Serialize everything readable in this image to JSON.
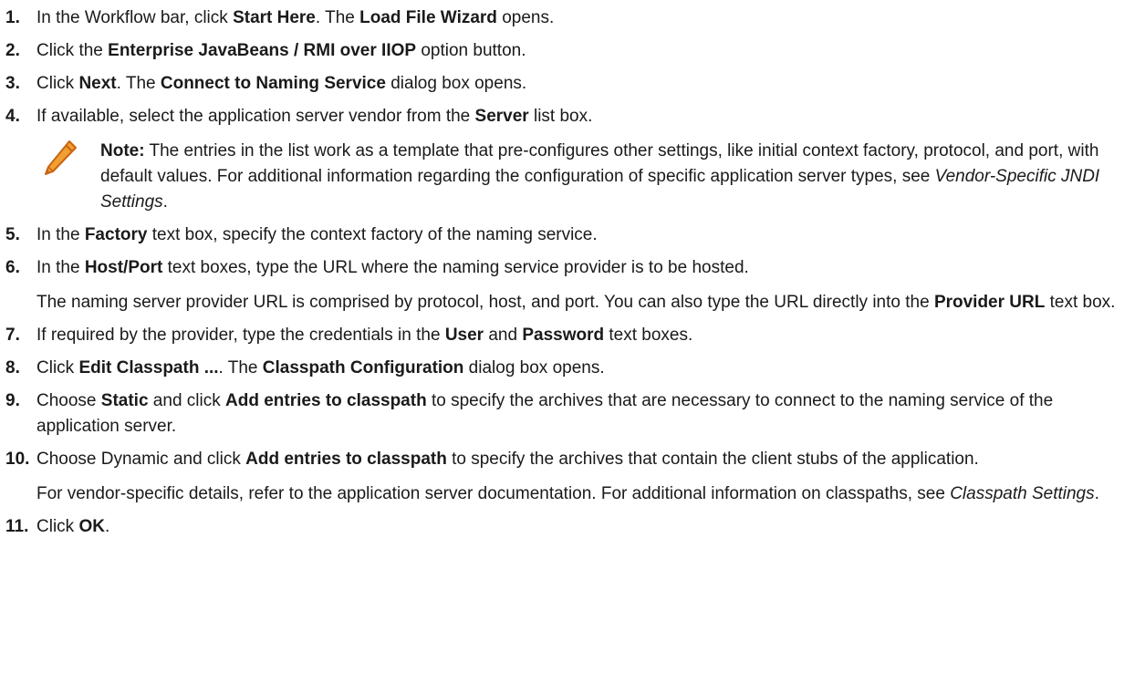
{
  "steps": [
    {
      "num": "1.",
      "parts": [
        {
          "t": "In the Workflow bar, click "
        },
        {
          "t": "Start Here",
          "b": true
        },
        {
          "t": ". The "
        },
        {
          "t": "Load File Wizard",
          "b": true
        },
        {
          "t": " opens."
        }
      ]
    },
    {
      "num": "2.",
      "parts": [
        {
          "t": "Click the "
        },
        {
          "t": "Enterprise JavaBeans / RMI over IIOP",
          "b": true
        },
        {
          "t": " option button."
        }
      ]
    },
    {
      "num": "3.",
      "parts": [
        {
          "t": "Click "
        },
        {
          "t": "Next",
          "b": true
        },
        {
          "t": ". The "
        },
        {
          "t": "Connect to Naming Service",
          "b": true
        },
        {
          "t": " dialog box opens."
        }
      ]
    },
    {
      "num": "4.",
      "parts": [
        {
          "t": "If available, select the application server vendor from the "
        },
        {
          "t": "Server",
          "b": true
        },
        {
          "t": " list box."
        }
      ],
      "note": {
        "label": "Note:",
        "parts": [
          {
            "t": " The entries in the list work as a template that pre-configures other settings, like initial context factory, protocol, and port, with default values. For additional information regarding the configuration of specific application server types, see "
          },
          {
            "t": "Vendor-Specific JNDI Settings",
            "i": true
          },
          {
            "t": "."
          }
        ]
      }
    },
    {
      "num": "5.",
      "parts": [
        {
          "t": "In the "
        },
        {
          "t": "Factory",
          "b": true
        },
        {
          "t": " text box, specify the context factory of the naming service."
        }
      ]
    },
    {
      "num": "6.",
      "parts": [
        {
          "t": "In the "
        },
        {
          "t": "Host/Port",
          "b": true
        },
        {
          "t": " text boxes, type the URL where the naming service provider is to be hosted."
        }
      ],
      "extra": [
        {
          "t": "The naming server provider URL is comprised by protocol, host, and port. You can also type the URL directly into the "
        },
        {
          "t": "Provider URL",
          "b": true
        },
        {
          "t": " text box."
        }
      ]
    },
    {
      "num": "7.",
      "parts": [
        {
          "t": "If required by the provider, type the credentials in the "
        },
        {
          "t": "User",
          "b": true
        },
        {
          "t": " and "
        },
        {
          "t": "Password",
          "b": true
        },
        {
          "t": " text boxes."
        }
      ]
    },
    {
      "num": "8.",
      "parts": [
        {
          "t": "Click "
        },
        {
          "t": "Edit Classpath ...",
          "b": true
        },
        {
          "t": ". The "
        },
        {
          "t": "Classpath Configuration",
          "b": true
        },
        {
          "t": " dialog box opens."
        }
      ]
    },
    {
      "num": "9.",
      "parts": [
        {
          "t": "Choose "
        },
        {
          "t": "Static",
          "b": true
        },
        {
          "t": " and click "
        },
        {
          "t": "Add entries to classpath",
          "b": true
        },
        {
          "t": " to specify the archives that are necessary to connect to the naming service of the application server."
        }
      ]
    },
    {
      "num": "10.",
      "parts": [
        {
          "t": "Choose Dynamic and click "
        },
        {
          "t": "Add entries to classpath",
          "b": true
        },
        {
          "t": " to specify the archives that contain the client stubs of the application."
        }
      ],
      "extra": [
        {
          "t": "For vendor-specific details, refer to the application server documentation. For additional information on classpaths, see "
        },
        {
          "t": "Classpath Settings",
          "i": true
        },
        {
          "t": "."
        }
      ]
    },
    {
      "num": "11.",
      "parts": [
        {
          "t": "Click "
        },
        {
          "t": "OK",
          "b": true
        },
        {
          "t": "."
        }
      ]
    }
  ],
  "icons": {
    "note": "pencil-icon"
  },
  "colors": {
    "pencil_body": "#f0a030",
    "pencil_outline": "#c86414",
    "text": "#1a1a1a"
  }
}
